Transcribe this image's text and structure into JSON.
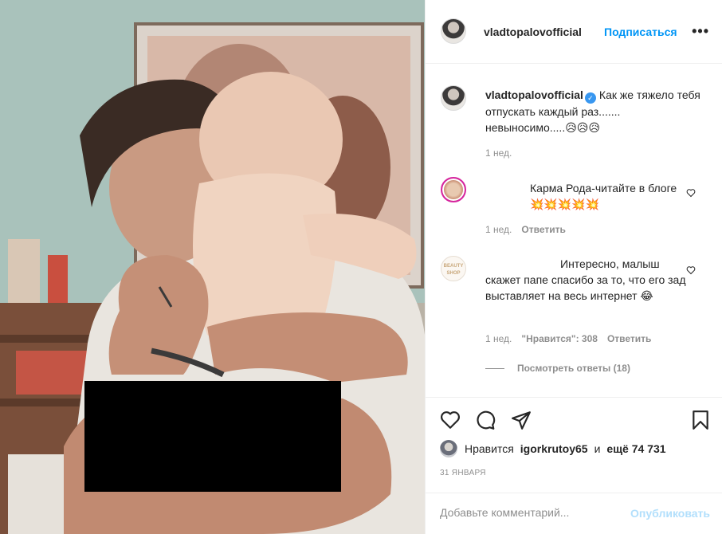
{
  "post": {
    "username": "vladtopalovofficial",
    "follow_label": "Подписаться",
    "more_icon": "more-options-icon",
    "more_label": "•••"
  },
  "caption": {
    "username": "vladtopalovofficial",
    "verified_mark": "✓",
    "text": "Как же тяжело тебя отпускать каждый раз....... невыносимо.....😥😥😥",
    "time": "1 нед."
  },
  "comments": [
    {
      "text": "Карма Рода-читайте в блоге💥💥💥💥💥",
      "time": "1 нед.",
      "reply_label": "Ответить"
    },
    {
      "avatar_text": "BEAUTY SHOP",
      "text": "Интересно, малыш скажет папе спасибо за то, что его зад выставляет на весь интернет 😂",
      "time": "1 нед.",
      "likes_label": "\"Нравится\": 308",
      "reply_label": "Ответить",
      "view_replies": "Посмотреть ответы (18)"
    }
  ],
  "actions": {
    "icons": [
      "heart-icon",
      "comment-icon",
      "share-icon",
      "bookmark-icon"
    ],
    "likes_prefix": "Нравится",
    "likes_user": "igorkrutoy65",
    "likes_and": "и",
    "likes_rest": "ещё 74 731",
    "date": "31 ЯНВАРЯ"
  },
  "add_comment": {
    "placeholder": "Добавьте комментарий...",
    "publish_label": "Опубликовать"
  },
  "colors": {
    "link_blue": "#0095f6",
    "verified_blue": "#3897f0",
    "publish_disabled": "#b2dffc",
    "muted_text": "#8e8e8e"
  }
}
